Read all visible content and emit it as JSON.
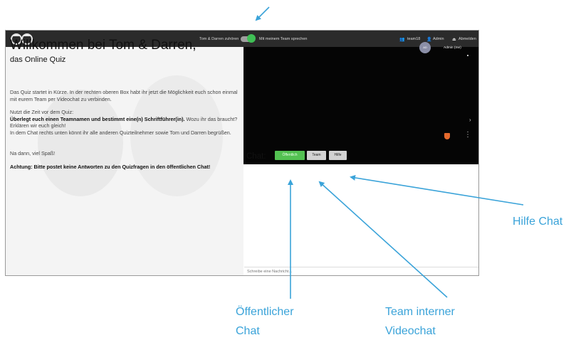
{
  "header": {
    "toggle_left_label": "Tom & Darren zuhören",
    "toggle_right_label": "Mit meinem Team sprechen",
    "team_name": "team18",
    "user_name": "Admin",
    "logout_label": "Abmelden"
  },
  "intro": {
    "title": "Willkommen bei Tom & Darren,",
    "subtitle": "das Online Quiz",
    "para1": "Das Quiz startet in Kürze. In der rechten oberen Box habt ihr jetzt die Möglichkeit euch schon einmal mit eurem Team per Videochat zu verbinden.",
    "para2_line1": "Nutzt die Zeit vor dem Quiz:",
    "para2_bold": "Überlegt euch einen Teamnamen und bestimmt eine(n) Schriftführer(in).",
    "para2_rest": " Wozu ihr das braucht? Erklären wir euch gleich!",
    "para2_line3": "In dem Chat rechts unten könnt ihr alle anderen Quizteilnehmer sowie Tom und Darren begrüßen.",
    "para3": "Na dann, viel Spaß!",
    "warning": "Achtung: Bitte postet keine Antworten zu den Quizfragen in den öffentlichen Chat!"
  },
  "video": {
    "avatar_initials": "AD",
    "participant_name": "Admin (me)"
  },
  "chat": {
    "label": "Chat:",
    "tabs": [
      "Öffentlich",
      "Team",
      "Hilfe"
    ],
    "input_placeholder": "Schreibe eine Nachricht..."
  },
  "annotations": {
    "help_chat": "Hilfe Chat",
    "public_chat_line1": "Öffentlicher",
    "public_chat_line2": "Chat",
    "team_video_line1": "Team interner",
    "team_video_line2": "Videochat"
  },
  "colors": {
    "accent_annotation": "#3aa3d9",
    "topbar": "#2b2b2b",
    "public_chip": "#53c152",
    "toggle_on": "#3fbf55"
  }
}
